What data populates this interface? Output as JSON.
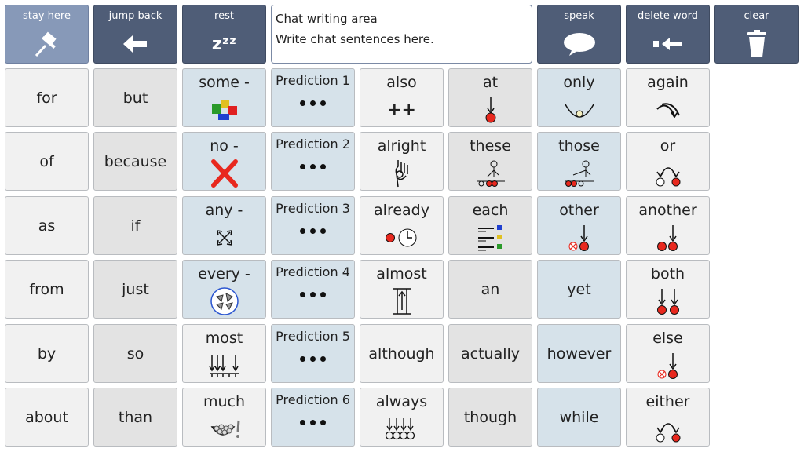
{
  "toolbar": {
    "stay_here": "stay here",
    "jump_back": "jump back",
    "rest": "rest",
    "rest_glyph": "zᶻᶻ",
    "speak": "speak",
    "delete_word": "delete word",
    "clear": "clear"
  },
  "chat": {
    "title": "Chat writing area",
    "placeholder": "Write chat sentences here."
  },
  "grid": {
    "col1": [
      "for",
      "of",
      "as",
      "from",
      "by",
      "about"
    ],
    "col2": [
      "but",
      "because",
      "if",
      "just",
      "so",
      "than"
    ],
    "col3": [
      "some -",
      "no -",
      "any -",
      "every -",
      "most",
      "much"
    ],
    "col4": [
      "Prediction 1",
      "Prediction 2",
      "Prediction 3",
      "Prediction 4",
      "Prediction 5",
      "Prediction 6"
    ],
    "col5": [
      "also",
      "alright",
      "already",
      "almost",
      "although",
      "always"
    ],
    "col5_also_glyph": "++",
    "col6": [
      "at",
      "these",
      "each",
      "an",
      "actually",
      "though"
    ],
    "col7": [
      "only",
      "those",
      "other",
      "yet",
      "however",
      "while"
    ],
    "col8": [
      "again",
      "or",
      "another",
      "both",
      "else",
      "either"
    ]
  },
  "colors": {
    "toolbar": "#4f5d77",
    "toolbar_active": "#8799b8",
    "cell_white": "#f1f1f1",
    "cell_grey": "#e3e3e3",
    "cell_blue": "#d6e2ea",
    "red_dot": "#e8281e"
  }
}
